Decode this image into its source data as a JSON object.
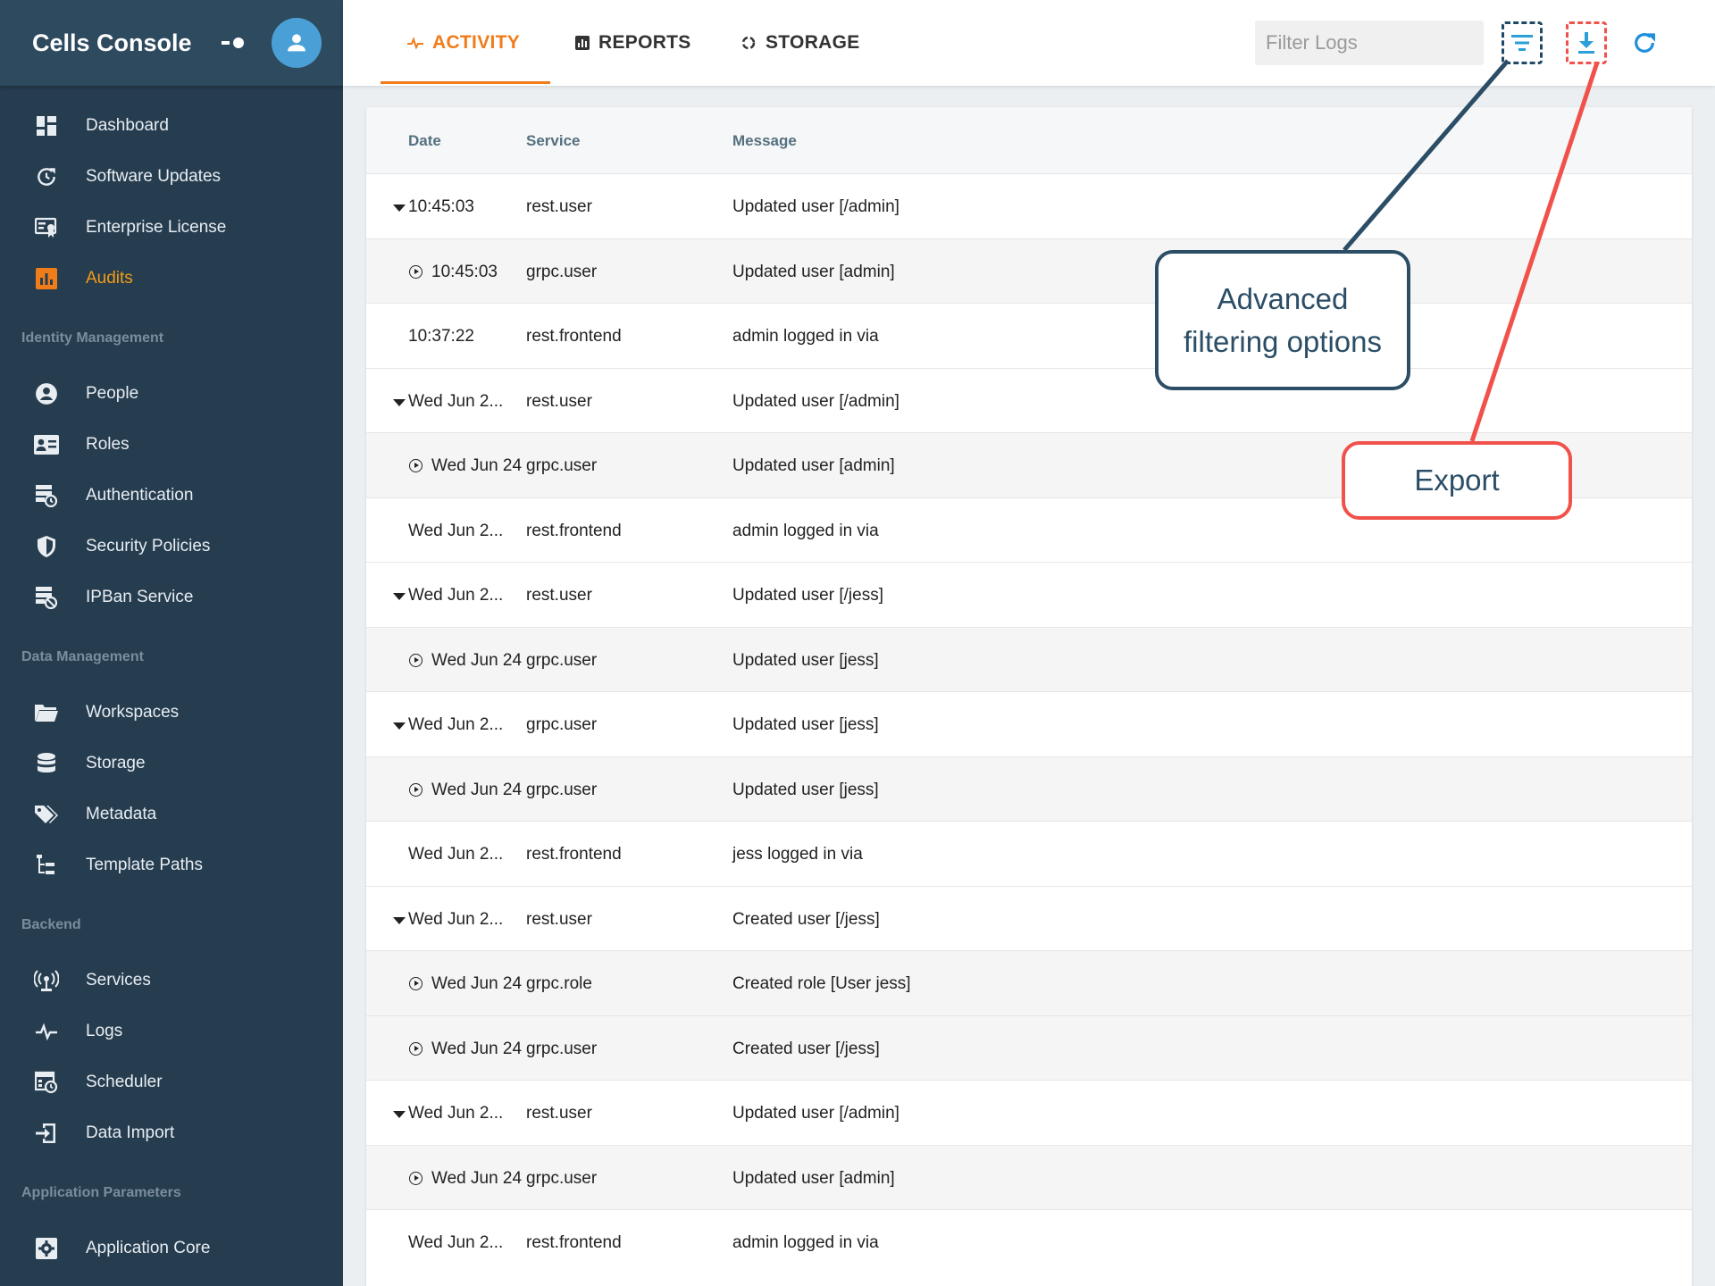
{
  "app": {
    "title": "Cells Console"
  },
  "sidebar": {
    "groups": [
      {
        "title": "",
        "items": [
          {
            "label": "Dashboard",
            "icon": "dashboard-icon"
          },
          {
            "label": "Software Updates",
            "icon": "update-icon"
          },
          {
            "label": "Enterprise License",
            "icon": "license-icon"
          },
          {
            "label": "Audits",
            "icon": "audits-icon",
            "active": true
          }
        ]
      },
      {
        "title": "Identity Management",
        "items": [
          {
            "label": "People",
            "icon": "person-icon"
          },
          {
            "label": "Roles",
            "icon": "roles-icon"
          },
          {
            "label": "Authentication",
            "icon": "authentication-icon"
          },
          {
            "label": "Security Policies",
            "icon": "shield-icon"
          },
          {
            "label": "IPBan Service",
            "icon": "ipban-icon"
          }
        ]
      },
      {
        "title": "Data Management",
        "items": [
          {
            "label": "Workspaces",
            "icon": "folder-icon"
          },
          {
            "label": "Storage",
            "icon": "database-icon"
          },
          {
            "label": "Metadata",
            "icon": "tags-icon"
          },
          {
            "label": "Template Paths",
            "icon": "tree-icon"
          }
        ]
      },
      {
        "title": "Backend",
        "items": [
          {
            "label": "Services",
            "icon": "services-icon"
          },
          {
            "label": "Logs",
            "icon": "pulse-icon"
          },
          {
            "label": "Scheduler",
            "icon": "scheduler-icon"
          },
          {
            "label": "Data Import",
            "icon": "import-icon"
          }
        ]
      },
      {
        "title": "Application Parameters",
        "items": [
          {
            "label": "Application Core",
            "icon": "settings-box-icon"
          }
        ]
      }
    ]
  },
  "tabs": [
    {
      "label": "ACTIVITY",
      "icon": "pulse-icon",
      "active": true
    },
    {
      "label": "REPORTS",
      "icon": "chart-icon"
    },
    {
      "label": "STORAGE",
      "icon": "loading-icon"
    }
  ],
  "toolbar": {
    "filter_placeholder": "Filter Logs"
  },
  "table": {
    "headers": {
      "date": "Date",
      "service": "Service",
      "message": "Message"
    },
    "rows": [
      {
        "kind": "parent",
        "date": "10:45:03",
        "service": "rest.user",
        "message": "Updated user [/admin]"
      },
      {
        "kind": "child",
        "date": "10:45:03",
        "service": "grpc.user",
        "message": "Updated user [admin]"
      },
      {
        "kind": "plain",
        "date": "10:37:22",
        "service": "rest.frontend",
        "message": "admin logged in via"
      },
      {
        "kind": "parent",
        "date": "Wed Jun 2...",
        "service": "rest.user",
        "message": "Updated user [/admin]"
      },
      {
        "kind": "child",
        "date": "Wed Jun 24",
        "service": "grpc.user",
        "message": "Updated user [admin]"
      },
      {
        "kind": "plain",
        "date": "Wed Jun 2...",
        "service": "rest.frontend",
        "message": "admin logged in via"
      },
      {
        "kind": "parent",
        "date": "Wed Jun 2...",
        "service": "rest.user",
        "message": "Updated user [/jess]"
      },
      {
        "kind": "child",
        "date": "Wed Jun 24",
        "service": "grpc.user",
        "message": "Updated user [jess]"
      },
      {
        "kind": "parent",
        "date": "Wed Jun 2...",
        "service": "grpc.user",
        "message": "Updated user [jess]"
      },
      {
        "kind": "child",
        "date": "Wed Jun 24",
        "service": "grpc.user",
        "message": "Updated user [jess]"
      },
      {
        "kind": "plain",
        "date": "Wed Jun 2...",
        "service": "rest.frontend",
        "message": "jess logged in via"
      },
      {
        "kind": "parent",
        "date": "Wed Jun 2...",
        "service": "rest.user",
        "message": "Created user [/jess]"
      },
      {
        "kind": "child",
        "date": "Wed Jun 24",
        "service": "grpc.role",
        "message": "Created role [User jess]"
      },
      {
        "kind": "child",
        "date": "Wed Jun 24",
        "service": "grpc.user",
        "message": "Created user [/jess]"
      },
      {
        "kind": "parent",
        "date": "Wed Jun 2...",
        "service": "rest.user",
        "message": "Updated user [/admin]"
      },
      {
        "kind": "child",
        "date": "Wed Jun 24",
        "service": "grpc.user",
        "message": "Updated user [admin]"
      },
      {
        "kind": "plain",
        "date": "Wed Jun 2...",
        "service": "rest.frontend",
        "message": "admin logged in via"
      }
    ]
  },
  "callouts": {
    "advanced": {
      "line1": "Advanced",
      "line2": "filtering options"
    },
    "export": {
      "label": "Export"
    }
  },
  "colors": {
    "sidebar_bg": "#263d50",
    "accent": "#f07c1a",
    "callout_blue": "#2b4e66",
    "callout_red": "#f0524b",
    "refresh_blue": "#1e8fdc"
  }
}
